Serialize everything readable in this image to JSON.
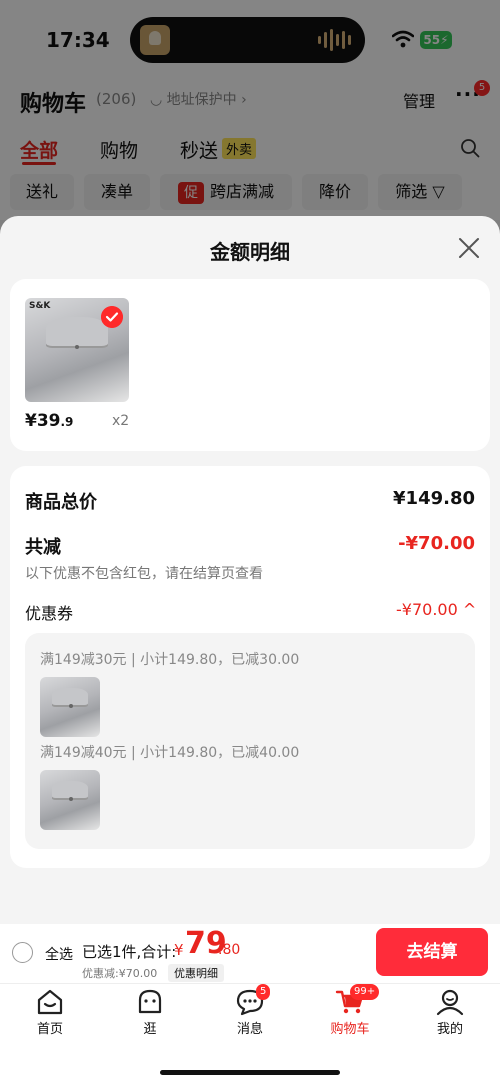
{
  "status": {
    "time": "17:34",
    "battery": "55"
  },
  "header": {
    "title": "购物车",
    "count": "(206)",
    "address": "地址保护中",
    "manage": "管理",
    "more_badge": "5",
    "tabs": [
      {
        "label": "全部"
      },
      {
        "label": "购物"
      },
      {
        "label": "秒送"
      }
    ],
    "takeout_tag": "外卖",
    "chips": [
      {
        "label": "送礼"
      },
      {
        "label": "凑单"
      },
      {
        "label": "跨店满减",
        "icon": "促"
      },
      {
        "label": "降价"
      },
      {
        "label": "筛选"
      }
    ]
  },
  "sheet": {
    "title": "金额明细",
    "item": {
      "price_int": "¥39",
      "price_dec": ".9",
      "qty": "x2",
      "logo": "S&K"
    },
    "summary": {
      "total_label": "商品总价",
      "total_value": "¥149.80",
      "reduce_label": "共减",
      "reduce_value": "-¥70.00",
      "note": "以下优惠不包含红包，请在结算页查看",
      "coupon_label": "优惠券",
      "coupon_value": "-¥70.00"
    },
    "coupons": [
      {
        "rule": "满149减30元",
        "detail": "小计149.80，已减30.00"
      },
      {
        "rule": "满149减40元",
        "detail": "小计149.80，已减40.00"
      }
    ]
  },
  "bottom": {
    "select_all": "全选",
    "selected_text": "已选1件,合计:",
    "total_symbol": "¥",
    "total_int": "79",
    "total_dec": ".80",
    "discount": "优惠减:¥70.00",
    "detail_link": "优惠明细",
    "checkout": "去结算"
  },
  "nav": [
    {
      "label": "首页",
      "icon": "home-icon"
    },
    {
      "label": "逛",
      "icon": "browse-icon"
    },
    {
      "label": "消息",
      "icon": "message-icon",
      "badge": "5"
    },
    {
      "label": "购物车",
      "icon": "cart-icon",
      "badge": "99+",
      "active": true
    },
    {
      "label": "我的",
      "icon": "profile-icon"
    }
  ],
  "colors": {
    "accent": "#e8251f",
    "checkout": "#ff2c3a"
  }
}
